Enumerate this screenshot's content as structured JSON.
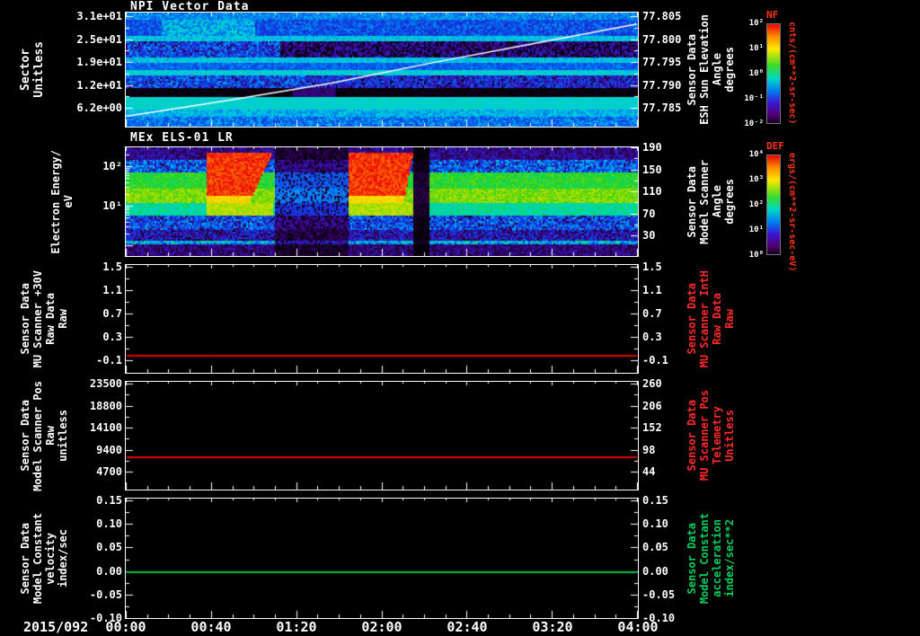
{
  "xaxis": {
    "date_label": "2015/092",
    "tick_labels": [
      "00:00",
      "00:40",
      "01:20",
      "02:00",
      "02:40",
      "03:20",
      "04:00"
    ]
  },
  "chart_data": [
    {
      "type": "heatmap",
      "title": "NPI Vector Data",
      "ylabel_lines": [
        "Sector",
        "Unitless"
      ],
      "ytick_labels": [
        "3.1e+01",
        "2.5e+01",
        "1.9e+01",
        "1.2e+01",
        "6.2e+00"
      ],
      "right_axis": {
        "label_lines": [
          "Sensor Data",
          "ESH Sun Elevation",
          "Angle",
          "degrees"
        ],
        "tick_labels": [
          "77.805",
          "77.800",
          "77.795",
          "77.790",
          "77.785"
        ],
        "color": "#ffffff"
      },
      "colorbar": {
        "name": "NF",
        "units": "cnts/(cm**2-sr-sec)",
        "tick_labels": [
          "10²",
          "10¹",
          "10⁰",
          "10⁻¹",
          "10⁻²"
        ],
        "label_color": "#ff3318"
      },
      "overlay_line": {
        "name": "ESH Sun Elevation Angle",
        "color": "#ffffff",
        "start_value": 77.787,
        "end_value": 77.805,
        "path": [
          [
            0,
            0.91
          ],
          [
            0.2,
            0.77
          ],
          [
            0.4,
            0.62
          ],
          [
            0.6,
            0.44
          ],
          [
            0.8,
            0.27
          ],
          [
            1,
            0.1
          ]
        ]
      },
      "bands": [
        {
          "y0": 0.0,
          "y1": 0.05,
          "v": 0.34,
          "n": 0.05
        },
        {
          "y0": 0.05,
          "y1": 0.19,
          "v": 0.28,
          "n": 0.07
        },
        {
          "y0": 0.19,
          "y1": 0.24,
          "v": 0.4,
          "n": 0.04
        },
        {
          "y0": 0.24,
          "y1": 0.39,
          "v": 0.27,
          "n": 0.1
        },
        {
          "y0": 0.39,
          "y1": 0.44,
          "v": 0.4,
          "n": 0.04
        },
        {
          "y0": 0.44,
          "y1": 0.49,
          "v": 0.3,
          "n": 0.05
        },
        {
          "y0": 0.49,
          "y1": 0.54,
          "v": 0.42,
          "n": 0.04
        },
        {
          "y0": 0.54,
          "y1": 0.65,
          "v": 0.28,
          "n": 0.09
        },
        {
          "y0": 0.65,
          "y1": 0.74,
          "v": 0.02,
          "n": 0.02
        },
        {
          "y0": 0.74,
          "y1": 0.85,
          "v": 0.43,
          "n": 0.03
        },
        {
          "y0": 0.85,
          "y1": 0.9,
          "v": 0.38,
          "n": 0.05
        },
        {
          "y0": 0.9,
          "y1": 1.01,
          "v": 0.32,
          "n": 0.07
        }
      ],
      "features": [
        {
          "x0": 0.07,
          "x1": 0.25,
          "y0": 0.05,
          "y1": 0.19,
          "dv": 0.1
        },
        {
          "x0": 0.3,
          "x1": 1.0,
          "y0": 0.24,
          "y1": 0.39,
          "dv": -0.15
        },
        {
          "x0": 0.325,
          "x1": 0.41,
          "y0": 0.65,
          "y1": 0.74,
          "dv": 0.1
        },
        {
          "x0": 0.35,
          "x1": 1.0,
          "y0": 0.54,
          "y1": 0.65,
          "dv": -0.06
        }
      ]
    },
    {
      "type": "heatmap",
      "title": "MEx ELS-01 LR",
      "ylabel_lines": [
        "Electron Energy/",
        "eV"
      ],
      "ytick_labels": [
        "10²",
        "10¹"
      ],
      "right_axis": {
        "label_lines": [
          "Sensor Data",
          "Model Scanner",
          "Angle",
          "degrees"
        ],
        "tick_labels": [
          "190",
          "150",
          "110",
          "70",
          "30"
        ],
        "color": "#ffffff"
      },
      "colorbar": {
        "name": "DEF",
        "units": "ergs/(cm**2-sr-sec-eV)",
        "tick_labels": [
          "10⁴",
          "10³",
          "10²",
          "10¹",
          "10⁰"
        ],
        "label_color": "#ff3318"
      },
      "bands": [
        {
          "y0": 0.0,
          "y1": 0.1,
          "v": 0.14,
          "n": 0.08
        },
        {
          "y0": 0.1,
          "y1": 0.22,
          "v": 0.3,
          "n": 0.1
        },
        {
          "y0": 0.22,
          "y1": 0.38,
          "v": 0.58,
          "n": 0.06
        },
        {
          "y0": 0.38,
          "y1": 0.5,
          "v": 0.66,
          "n": 0.06
        },
        {
          "y0": 0.5,
          "y1": 0.62,
          "v": 0.48,
          "n": 0.07
        },
        {
          "y0": 0.62,
          "y1": 0.75,
          "v": 0.28,
          "n": 0.1
        },
        {
          "y0": 0.75,
          "y1": 0.87,
          "v": 0.18,
          "n": 0.1
        },
        {
          "y0": 0.87,
          "y1": 1.01,
          "v": 0.12,
          "n": 0.08
        }
      ],
      "features": [
        {
          "x0": 0.0,
          "x1": 1.0,
          "y0": 0.855,
          "y1": 0.885,
          "dv": 0.24
        }
      ],
      "blobs": [
        {
          "x0": 0.155,
          "x1": 0.285,
          "y0": 0.04,
          "y1": 0.5,
          "v": 0.96,
          "taper": 0.35
        },
        {
          "x0": 0.435,
          "x1": 0.56,
          "y0": 0.04,
          "y1": 0.5,
          "v": 0.96,
          "taper": 0.15
        }
      ],
      "gaps": [
        {
          "x0": 0.29,
          "x1": 0.435,
          "f": 0.5
        },
        {
          "x0": 0.56,
          "x1": 0.59,
          "f": 0.12
        }
      ]
    },
    {
      "type": "line",
      "left_axis": {
        "label_lines": [
          "Sensor Data",
          "MU Scanner +30V",
          "Raw Data",
          "Raw"
        ],
        "tick_labels": [
          "1.5",
          "1.1",
          "0.7",
          "0.3",
          "-0.1"
        ],
        "color": "#ffffff"
      },
      "right_axis": {
        "label_lines": [
          "Sensor Data",
          "MU Scanner IntH",
          "Raw Data",
          "Raw"
        ],
        "tick_labels": [
          "1.5",
          "1.1",
          "0.7",
          "0.3",
          "-0.1"
        ],
        "color": "#ff2a2a"
      },
      "y_top_value": 1.5,
      "y_step_value": 0.4,
      "series": [
        {
          "name": "MU Scanner IntH Raw Data",
          "color": "#e00000",
          "constant_value": 0.0
        }
      ]
    },
    {
      "type": "line",
      "left_axis": {
        "label_lines": [
          "Sensor Data",
          "Model Scanner Pos",
          "Raw",
          "unitless"
        ],
        "tick_labels": [
          "23500",
          "18800",
          "14100",
          "9400",
          "4700"
        ],
        "color": "#ffffff"
      },
      "right_axis": {
        "label_lines": [
          "Sensor Data",
          "MU Scanner Pos",
          "Telemetry",
          "Unitless"
        ],
        "tick_labels": [
          "260",
          "206",
          "152",
          "98",
          "44"
        ],
        "color": "#ff2a2a"
      },
      "y_top_value": 23500,
      "y_step_value": 4700,
      "series": [
        {
          "name": "MU Scanner Pos Telemetry",
          "color": "#e00000",
          "constant_value": 8000
        }
      ]
    },
    {
      "type": "line",
      "left_axis": {
        "label_lines": [
          "Sensor Data",
          "Model Constant",
          "velocity",
          "index/sec"
        ],
        "tick_labels": [
          "0.15",
          "0.10",
          "0.05",
          "0.00",
          "-0.05",
          "-0.10"
        ],
        "color": "#ffffff"
      },
      "right_axis": {
        "label_lines": [
          "Sensor Data",
          "Model Constant",
          "acceleration",
          "index/sec**2"
        ],
        "tick_labels": [
          "0.15",
          "0.10",
          "0.05",
          "0.00",
          "-0.05",
          "-0.10"
        ],
        "color": "#00d060"
      },
      "y_top_value": 0.15,
      "y_step_value": 0.05,
      "series": [
        {
          "name": "Model Constant acceleration",
          "color": "#00c040",
          "constant_value": 0.0
        }
      ]
    }
  ]
}
